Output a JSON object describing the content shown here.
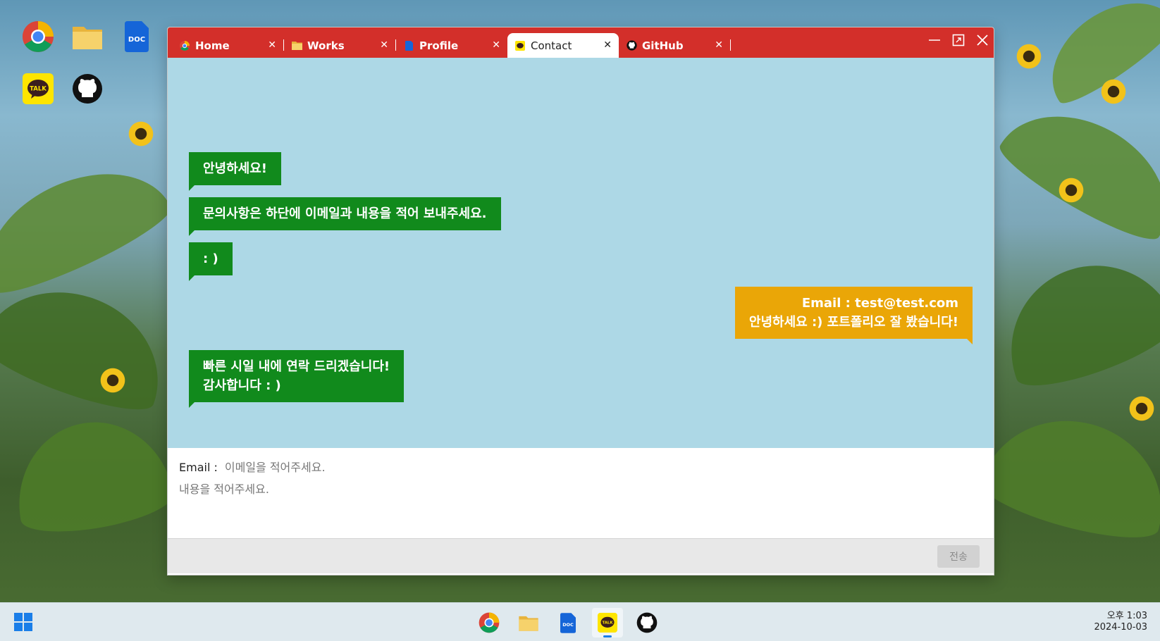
{
  "desktop": {
    "icons": [
      {
        "name": "chrome-icon"
      },
      {
        "name": "folder-icon"
      },
      {
        "name": "doc-icon",
        "label": "DOC"
      },
      {
        "name": "kakaotalk-icon",
        "label": "TALK"
      },
      {
        "name": "github-icon"
      }
    ]
  },
  "window": {
    "tabs": [
      {
        "label": "Home",
        "icon": "chrome-icon"
      },
      {
        "label": "Works",
        "icon": "folder-icon"
      },
      {
        "label": "Profile",
        "icon": "doc-icon"
      },
      {
        "label": "Contact",
        "icon": "kakaotalk-icon",
        "active": true
      },
      {
        "label": "GitHub",
        "icon": "github-icon"
      }
    ],
    "close_glyph": "✕"
  },
  "chat": {
    "msg1": "안녕하세요!",
    "msg2": "문의사항은 하단에 이메일과 내용을 적어 보내주세요.",
    "msg3": ": )",
    "reply_line1": "Email : test@test.com",
    "reply_line2": "안녕하세요 :) 포트폴리오 잘 봤습니다!",
    "msg4_line1": "빠른 시일 내에 연락 드리겠습니다!",
    "msg4_line2": "감사합니다 : )"
  },
  "compose": {
    "email_label": "Email :",
    "email_placeholder": "이메일을 적어주세요.",
    "content_placeholder": "내용을 적어주세요.",
    "send_label": "전송"
  },
  "taskbar": {
    "clock_time": "오후 1:03",
    "clock_date": "2024-10-03",
    "active_app": "kakaotalk"
  },
  "colors": {
    "titlebar": "#d32f2a",
    "chat_bg": "#add8e6",
    "bubble_left": "#118a1c",
    "bubble_right": "#eaa607"
  }
}
